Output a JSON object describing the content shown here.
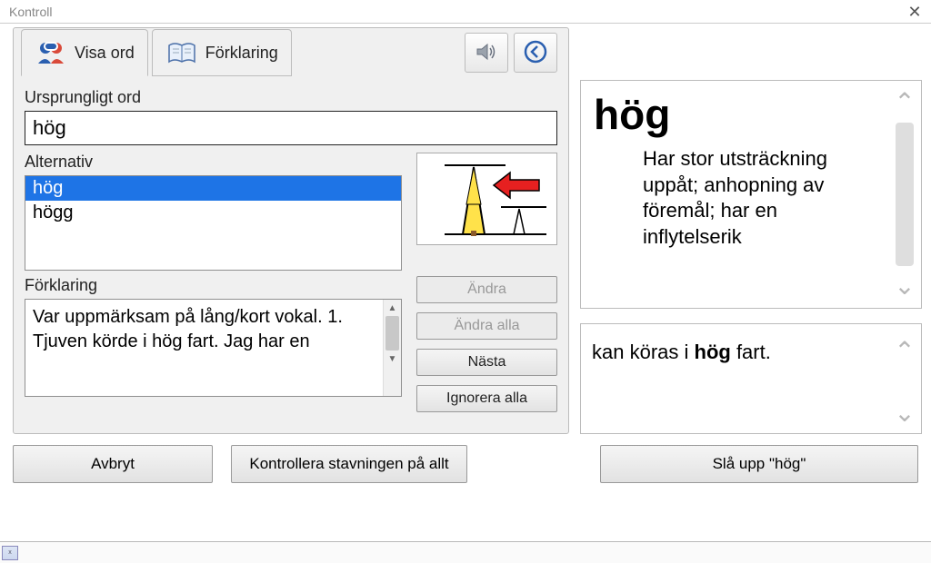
{
  "window": {
    "title": "Kontroll"
  },
  "tabs": {
    "visa_ord": "Visa ord",
    "forklaring": "Förklaring"
  },
  "labels": {
    "original_word": "Ursprungligt ord",
    "alternatives": "Alternativ",
    "explanation": "Förklaring"
  },
  "original_word_value": "hög",
  "alternatives": [
    "hög",
    "högg"
  ],
  "selected_alternative_index": 0,
  "explanation_text": "Var uppmärksam på lång/kort vokal. 1. Tjuven körde i hög fart. Jag har en",
  "buttons": {
    "change": "Ändra",
    "change_all": "Ändra alla",
    "next": "Nästa",
    "ignore_all": "Ignorera alla",
    "cancel": "Avbryt",
    "check_all": "Kontrollera stavningen på allt",
    "lookup": "Slå upp \"hög\""
  },
  "dictionary": {
    "headword": "hög",
    "definition": "Har stor utsträckning uppåt; anhopning av föremål; har en inflytelserik"
  },
  "example": {
    "prefix": "kan köras i ",
    "bold": "hög",
    "suffix": " fart."
  },
  "colors": {
    "selection": "#1e74e6",
    "panel_bg": "#f0f0f0"
  }
}
